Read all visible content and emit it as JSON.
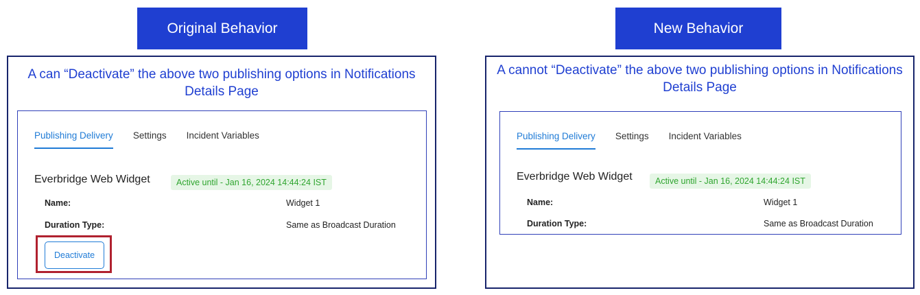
{
  "left": {
    "banner": "Original Behavior",
    "caption": "A can “Deactivate” the above two publishing options in Notifications Details Page",
    "tabs": [
      {
        "label": "Publishing Delivery"
      },
      {
        "label": "Settings"
      },
      {
        "label": "Incident Variables"
      }
    ],
    "widget_title": "Everbridge Web Widget",
    "badge": "Active until - Jan 16, 2024 14:44:24 IST",
    "fields": {
      "name_label": "Name:",
      "name_value": "Widget 1",
      "duration_label": "Duration Type:",
      "duration_value": "Same as Broadcast Duration"
    },
    "deactivate_label": "Deactivate"
  },
  "right": {
    "banner": "New Behavior",
    "caption": "A cannot “Deactivate” the above two publishing options in Notifications Details Page",
    "tabs": [
      {
        "label": "Publishing Delivery"
      },
      {
        "label": "Settings"
      },
      {
        "label": "Incident Variables"
      }
    ],
    "widget_title": "Everbridge Web Widget",
    "badge": "Active until - Jan 16, 2024 14:44:24 IST",
    "fields": {
      "name_label": "Name:",
      "name_value": "Widget 1",
      "duration_label": "Duration Type:",
      "duration_value": "Same as Broadcast Duration"
    }
  },
  "colors": {
    "banner_bg": "#1f3fd1",
    "caption_text": "#1f3fd1",
    "active_tab": "#1f7bd6",
    "badge_text": "#2fa52f",
    "badge_bg": "#e6f6e6",
    "highlight_border": "#b0212f"
  }
}
